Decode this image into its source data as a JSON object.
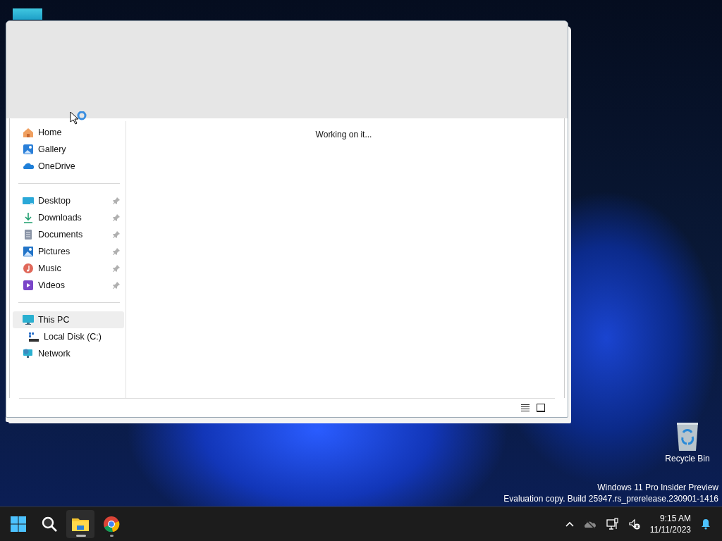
{
  "desktop_icons": [
    {
      "kind": "folder"
    },
    {
      "kind": "recycle",
      "label": "Recycle Bin"
    }
  ],
  "window": {
    "status": "Working on it..."
  },
  "sidebar": {
    "groups": [
      {
        "items": [
          {
            "kind": "home",
            "label": "Home",
            "pinned": false,
            "selected": false
          },
          {
            "kind": "gallery",
            "label": "Gallery",
            "pinned": false,
            "selected": false
          },
          {
            "kind": "cloud",
            "label": "OneDrive",
            "pinned": false,
            "selected": false
          }
        ]
      },
      {
        "items": [
          {
            "kind": "desktop",
            "label": "Desktop",
            "pinned": true,
            "selected": false
          },
          {
            "kind": "download",
            "label": "Downloads",
            "pinned": true,
            "selected": false
          },
          {
            "kind": "document",
            "label": "Documents",
            "pinned": true,
            "selected": false
          },
          {
            "kind": "picture",
            "label": "Pictures",
            "pinned": true,
            "selected": false
          },
          {
            "kind": "music",
            "label": "Music",
            "pinned": true,
            "selected": false
          },
          {
            "kind": "video",
            "label": "Videos",
            "pinned": true,
            "selected": false
          }
        ]
      },
      {
        "items": [
          {
            "kind": "pc",
            "label": "This PC",
            "pinned": false,
            "selected": true,
            "children": [
              {
                "kind": "disk",
                "label": "Local Disk (C:)",
                "pinned": false,
                "selected": false
              }
            ]
          },
          {
            "kind": "network",
            "label": "Network",
            "pinned": false,
            "selected": false
          }
        ]
      }
    ]
  },
  "watermark_lines": [
    "Windows 11 Pro Insider Preview",
    "Evaluation copy. Build 25947.rs_prerelease.230901-1416"
  ],
  "taskbar": {
    "apps": [
      {
        "kind": "start",
        "selected": false,
        "running": false
      },
      {
        "kind": "search",
        "selected": false,
        "running": false
      },
      {
        "kind": "explorer",
        "selected": true,
        "running": true
      },
      {
        "kind": "chrome",
        "selected": false,
        "running": true
      }
    ],
    "tray": {
      "time": "9:15 AM",
      "date": "11/11/2023"
    }
  }
}
